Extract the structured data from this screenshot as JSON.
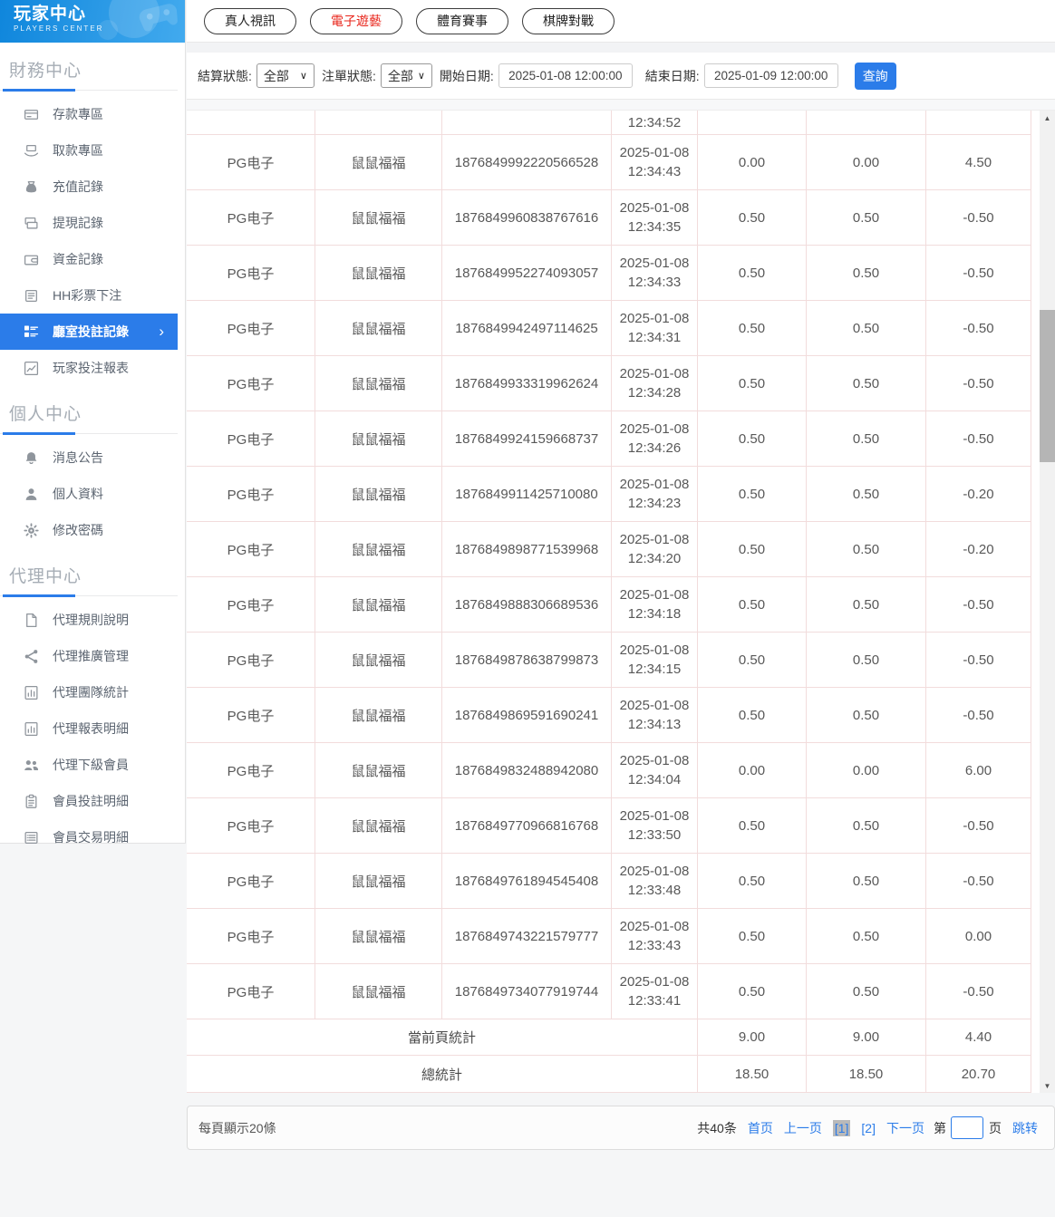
{
  "sidebar": {
    "title": "玩家中心",
    "subtitle": "PLAYERS CENTER",
    "sections": [
      {
        "heading": "財務中心",
        "items": [
          {
            "name": "deposit",
            "icon": "deposit-card-icon",
            "label": "存款專區"
          },
          {
            "name": "withdraw",
            "icon": "withdraw-hand-icon",
            "label": "取款專區"
          },
          {
            "name": "recharge-log",
            "icon": "moneybag-icon",
            "label": "充值記錄"
          },
          {
            "name": "cashout-log",
            "icon": "banknotes-icon",
            "label": "提現記錄"
          },
          {
            "name": "funds-log",
            "icon": "wallet-icon",
            "label": "資金記錄"
          },
          {
            "name": "hh-lottery",
            "icon": "list-box-icon",
            "label": "HH彩票下注"
          },
          {
            "name": "room-bet-log",
            "icon": "tree-list-icon",
            "label": "廳室投註記錄",
            "active": true
          },
          {
            "name": "player-report",
            "icon": "chart-box-icon",
            "label": "玩家投注報表"
          }
        ]
      },
      {
        "heading": "個人中心",
        "items": [
          {
            "name": "announcements",
            "icon": "bell-icon",
            "label": "消息公告"
          },
          {
            "name": "profile",
            "icon": "person-icon",
            "label": "個人資料"
          },
          {
            "name": "password",
            "icon": "gear-icon",
            "label": "修改密碼"
          }
        ]
      },
      {
        "heading": "代理中心",
        "items": [
          {
            "name": "agent-rules",
            "icon": "document-icon",
            "label": "代理規則說明"
          },
          {
            "name": "agent-promo",
            "icon": "share-icon",
            "label": "代理推廣管理"
          },
          {
            "name": "agent-team",
            "icon": "stats-page-icon",
            "label": "代理團隊統計"
          },
          {
            "name": "agent-report",
            "icon": "stats-page-icon",
            "label": "代理報表明細"
          },
          {
            "name": "agent-members",
            "icon": "users-icon",
            "label": "代理下級會員"
          },
          {
            "name": "member-bets",
            "icon": "clipboard-icon",
            "label": "會員投註明細"
          },
          {
            "name": "member-trades",
            "icon": "list-lines-icon",
            "label": "會員交易明細"
          }
        ]
      }
    ]
  },
  "tabs": [
    {
      "name": "live-casino",
      "label": "真人視訊",
      "active": false
    },
    {
      "name": "electronic-games",
      "label": "電子遊藝",
      "active": true
    },
    {
      "name": "sports",
      "label": "體育賽事",
      "active": false
    },
    {
      "name": "board-games",
      "label": "棋牌對戰",
      "active": false
    }
  ],
  "filters": {
    "settle_label": "結算狀態:",
    "settle_value": "全部",
    "order_label": "注單狀態:",
    "order_value": "全部",
    "start_label": "開始日期:",
    "start_value": "2025-01-08 12:00:00",
    "end_label": "結束日期:",
    "end_value": "2025-01-09 12:00:00",
    "query_label": "查詢"
  },
  "table": {
    "partial_row_time": "12:34:52",
    "rows": [
      {
        "provider": "PG电子",
        "game": "鼠鼠福福",
        "id": "1876849992220566528",
        "date": "2025-01-08",
        "time": "12:34:43",
        "bet": "0.00",
        "valid": "0.00",
        "result": "4.50"
      },
      {
        "provider": "PG电子",
        "game": "鼠鼠福福",
        "id": "1876849960838767616",
        "date": "2025-01-08",
        "time": "12:34:35",
        "bet": "0.50",
        "valid": "0.50",
        "result": "-0.50"
      },
      {
        "provider": "PG电子",
        "game": "鼠鼠福福",
        "id": "1876849952274093057",
        "date": "2025-01-08",
        "time": "12:34:33",
        "bet": "0.50",
        "valid": "0.50",
        "result": "-0.50"
      },
      {
        "provider": "PG电子",
        "game": "鼠鼠福福",
        "id": "1876849942497114625",
        "date": "2025-01-08",
        "time": "12:34:31",
        "bet": "0.50",
        "valid": "0.50",
        "result": "-0.50"
      },
      {
        "provider": "PG电子",
        "game": "鼠鼠福福",
        "id": "1876849933319962624",
        "date": "2025-01-08",
        "time": "12:34:28",
        "bet": "0.50",
        "valid": "0.50",
        "result": "-0.50"
      },
      {
        "provider": "PG电子",
        "game": "鼠鼠福福",
        "id": "1876849924159668737",
        "date": "2025-01-08",
        "time": "12:34:26",
        "bet": "0.50",
        "valid": "0.50",
        "result": "-0.50"
      },
      {
        "provider": "PG电子",
        "game": "鼠鼠福福",
        "id": "1876849911425710080",
        "date": "2025-01-08",
        "time": "12:34:23",
        "bet": "0.50",
        "valid": "0.50",
        "result": "-0.20"
      },
      {
        "provider": "PG电子",
        "game": "鼠鼠福福",
        "id": "1876849898771539968",
        "date": "2025-01-08",
        "time": "12:34:20",
        "bet": "0.50",
        "valid": "0.50",
        "result": "-0.20"
      },
      {
        "provider": "PG电子",
        "game": "鼠鼠福福",
        "id": "1876849888306689536",
        "date": "2025-01-08",
        "time": "12:34:18",
        "bet": "0.50",
        "valid": "0.50",
        "result": "-0.50"
      },
      {
        "provider": "PG电子",
        "game": "鼠鼠福福",
        "id": "1876849878638799873",
        "date": "2025-01-08",
        "time": "12:34:15",
        "bet": "0.50",
        "valid": "0.50",
        "result": "-0.50"
      },
      {
        "provider": "PG电子",
        "game": "鼠鼠福福",
        "id": "1876849869591690241",
        "date": "2025-01-08",
        "time": "12:34:13",
        "bet": "0.50",
        "valid": "0.50",
        "result": "-0.50"
      },
      {
        "provider": "PG电子",
        "game": "鼠鼠福福",
        "id": "1876849832488942080",
        "date": "2025-01-08",
        "time": "12:34:04",
        "bet": "0.00",
        "valid": "0.00",
        "result": "6.00"
      },
      {
        "provider": "PG电子",
        "game": "鼠鼠福福",
        "id": "1876849770966816768",
        "date": "2025-01-08",
        "time": "12:33:50",
        "bet": "0.50",
        "valid": "0.50",
        "result": "-0.50"
      },
      {
        "provider": "PG电子",
        "game": "鼠鼠福福",
        "id": "1876849761894545408",
        "date": "2025-01-08",
        "time": "12:33:48",
        "bet": "0.50",
        "valid": "0.50",
        "result": "-0.50"
      },
      {
        "provider": "PG电子",
        "game": "鼠鼠福福",
        "id": "1876849743221579777",
        "date": "2025-01-08",
        "time": "12:33:43",
        "bet": "0.50",
        "valid": "0.50",
        "result": "0.00"
      },
      {
        "provider": "PG电子",
        "game": "鼠鼠福福",
        "id": "1876849734077919744",
        "date": "2025-01-08",
        "time": "12:33:41",
        "bet": "0.50",
        "valid": "0.50",
        "result": "-0.50"
      }
    ],
    "page_summary": {
      "label": "當前頁統計",
      "v1": "9.00",
      "v2": "9.00",
      "v3": "4.40"
    },
    "total_summary": {
      "label": "總統計",
      "v1": "18.50",
      "v2": "18.50",
      "v3": "20.70"
    }
  },
  "pagination": {
    "page_size_text": "每頁顯示20條",
    "total_text": "共40条",
    "first": "首页",
    "prev": "上一页",
    "page1": "[1]",
    "page2": "[2]",
    "next": "下一页",
    "jump_prefix": "第",
    "jump_suffix": "页",
    "jump_action": "跳转",
    "jump_value": ""
  },
  "colors": {
    "accent": "#2b7ce9",
    "active_tab_text": "#e8241a",
    "table_border": "#f2dcdc"
  }
}
